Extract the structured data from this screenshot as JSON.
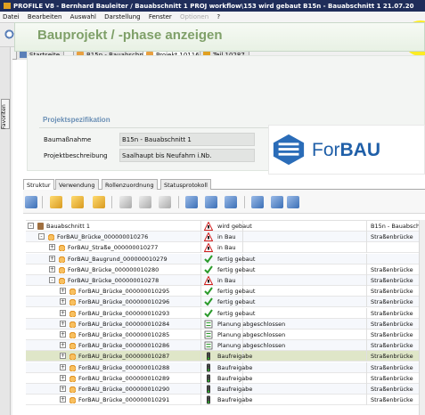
{
  "window": {
    "title": "PROFILE V8 - Bernhard Bauleiter / Bauabschnitt 1 PROJ workflow\\153 wird gebaut B15n - Bauabschnitt 1 21.07.20"
  },
  "menu": {
    "items": [
      "Datei",
      "Bearbeiten",
      "Auswahl",
      "Darstellung",
      "Fenster",
      "Optionen",
      "?"
    ]
  },
  "toolbar": {
    "search_value": ""
  },
  "sidebar": {
    "favorites_label": "Favoriten"
  },
  "tabs": [
    {
      "label": "Startseite",
      "icon": "home-icon"
    },
    {
      "label": "B15n - Bauabschnitt 1",
      "icon": "project-icon"
    },
    {
      "label": "Projekt 10116",
      "icon": "project-icon"
    },
    {
      "label": "Teil 10287",
      "icon": "part-icon"
    }
  ],
  "header": {
    "title": "Bauprojekt / -phase anzeigen"
  },
  "spec": {
    "section_title": "Projektspezifikation",
    "fields": [
      {
        "label": "Baumaßnahme",
        "value": "B15n - Bauabschnitt 1"
      },
      {
        "label": "Projektbeschreibung",
        "value": "Saalhaupt bis Neufahrn i.Nb."
      }
    ]
  },
  "logo": {
    "text_regular": "For",
    "text_bold": "BAU"
  },
  "subtabs": [
    "Struktur",
    "Verwendung",
    "Rollenzuordnung",
    "Statusprotokoll"
  ],
  "tree": {
    "rows": [
      {
        "level": 0,
        "toggle": "-",
        "label": "Bauabschnitt 1",
        "status_icon": "construction-sign-icon",
        "status": "wird gebaut",
        "type": "B15n - Bauabschn",
        "root": true
      },
      {
        "level": 1,
        "toggle": "-",
        "label": "ForBAU_Brücke_000000010276",
        "status_icon": "construction-sign-icon",
        "status": "in Bau",
        "type": "Straßenbrücke"
      },
      {
        "level": 2,
        "toggle": "+",
        "label": "ForBAU_Straße_000000010277",
        "status_icon": "construction-sign-icon",
        "status": "in Bau",
        "type": ""
      },
      {
        "level": 2,
        "toggle": "+",
        "label": "ForBAU_Baugrund_000000010279",
        "status_icon": "checkmark-icon",
        "status": "fertig gebaut",
        "type": ""
      },
      {
        "level": 2,
        "toggle": "+",
        "label": "ForBAU_Brücke_000000010280",
        "status_icon": "checkmark-icon",
        "status": "fertig gebaut",
        "type": "Straßenbrücke"
      },
      {
        "level": 2,
        "toggle": "-",
        "label": "ForBAU_Brücke_000000010278",
        "status_icon": "construction-sign-icon",
        "status": "in Bau",
        "type": "Straßenbrücke"
      },
      {
        "level": 3,
        "toggle": "+",
        "label": "ForBAU_Brücke_000000010295",
        "status_icon": "checkmark-icon",
        "status": "fertig gebaut",
        "type": "Straßenbrücke"
      },
      {
        "level": 3,
        "toggle": "+",
        "label": "ForBAU_Brücke_000000010296",
        "status_icon": "checkmark-icon",
        "status": "fertig gebaut",
        "type": "Straßenbrücke"
      },
      {
        "level": 3,
        "toggle": "+",
        "label": "ForBAU_Brücke_000000010293",
        "status_icon": "checkmark-icon",
        "status": "fertig gebaut",
        "type": "Straßenbrücke"
      },
      {
        "level": 3,
        "toggle": "+",
        "label": "ForBAU_Brücke_000000010284",
        "status_icon": "planning-icon",
        "status": "Planung abgeschlossen",
        "type": "Straßenbrücke"
      },
      {
        "level": 3,
        "toggle": "+",
        "label": "ForBAU_Brücke_000000010285",
        "status_icon": "planning-icon",
        "status": "Planung abgeschlossen",
        "type": "Straßenbrücke"
      },
      {
        "level": 3,
        "toggle": "+",
        "label": "ForBAU_Brücke_000000010286",
        "status_icon": "planning-icon",
        "status": "Planung abgeschlossen",
        "type": "Straßenbrücke"
      },
      {
        "level": 3,
        "toggle": "+",
        "label": "ForBAU_Brücke_000000010287",
        "status_icon": "traffic-light-icon",
        "status": "Baufreigabe",
        "type": "Straßenbrücke",
        "selected": true
      },
      {
        "level": 3,
        "toggle": "+",
        "label": "ForBAU_Brücke_000000010288",
        "status_icon": "traffic-light-icon",
        "status": "Baufreigabe",
        "type": "Straßenbrücke"
      },
      {
        "level": 3,
        "toggle": "+",
        "label": "ForBAU_Brücke_000000010289",
        "status_icon": "traffic-light-icon",
        "status": "Baufreigabe",
        "type": "Straßenbrücke"
      },
      {
        "level": 3,
        "toggle": "+",
        "label": "ForBAU_Brücke_000000010290",
        "status_icon": "traffic-light-icon",
        "status": "Baufreigabe",
        "type": "Straßenbrücke"
      },
      {
        "level": 3,
        "toggle": "+",
        "label": "ForBAU_Brücke_000000010291",
        "status_icon": "traffic-light-icon",
        "status": "Baufreigabe",
        "type": "Straßenbrücke"
      }
    ]
  },
  "colors": {
    "titlebar": "#1f2d5a",
    "header_title": "#7fa069",
    "section_title": "#6a8fb5",
    "logo_blue": "#1f5fa8",
    "selected_row": "#dfe6c8"
  }
}
